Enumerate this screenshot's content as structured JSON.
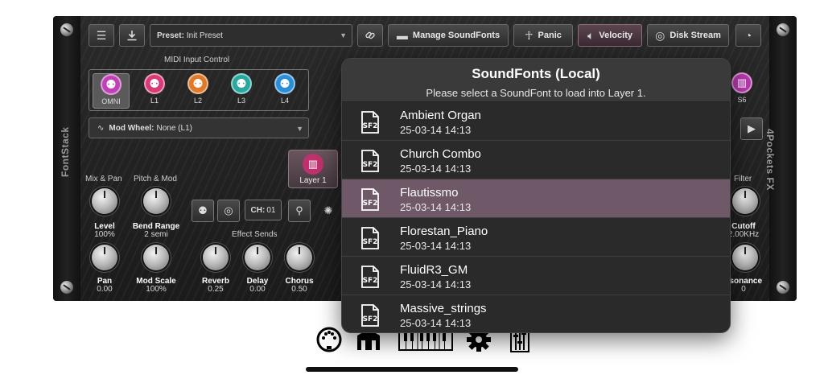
{
  "rack": {
    "side_left": "FontStack",
    "side_right": "4Pockets FX",
    "toolbar": {
      "preset_prefix": "Preset:",
      "preset_value": "Init Preset",
      "manage_soundfonts": "Manage SoundFonts",
      "panic": "Panic",
      "velocity": "Velocity",
      "disk_stream": "Disk Stream"
    },
    "midi_input_control": "MIDI Input Control",
    "midi_channels": [
      {
        "label": "OMNI",
        "color": "#c040b8"
      },
      {
        "label": "L1",
        "color": "#d83a78"
      },
      {
        "label": "L2",
        "color": "#e07a28"
      },
      {
        "label": "L3",
        "color": "#2aa8a0"
      },
      {
        "label": "L4",
        "color": "#2a8ed8"
      }
    ],
    "mod_wheel_prefix": "Mod Wheel:",
    "mod_wheel_value": "None (L1)",
    "layer_button": "Layer 1",
    "s6_label": "S6",
    "sections": {
      "mix_pan": "Mix & Pan",
      "pitch_mod": "Pitch & Mod",
      "effect_sends": "Effect Sends",
      "filter": "Filter"
    },
    "channel_box_prefix": "CH:",
    "channel_box_value": "01",
    "knobs": {
      "level": {
        "label": "Level",
        "value": "100%"
      },
      "bend_range": {
        "label": "Bend Range",
        "value": "2 semi"
      },
      "pan": {
        "label": "Pan",
        "value": "0.00"
      },
      "mod_scale": {
        "label": "Mod Scale",
        "value": "100%"
      },
      "reverb": {
        "label": "Reverb",
        "value": "0.25"
      },
      "delay": {
        "label": "Delay",
        "value": "0.00"
      },
      "chorus": {
        "label": "Chorus",
        "value": "0.50"
      },
      "cutoff": {
        "label": "Cutoff",
        "value": "2.00KHz"
      },
      "resonance": {
        "label": "esonance",
        "value": "0"
      }
    }
  },
  "popover": {
    "title": "SoundFonts (Local)",
    "subtitle": "Please select a SoundFont to load into Layer 1.",
    "icon_text": "SF2",
    "items": [
      {
        "name": "Ambient Organ",
        "date": "25-03-14 14:13"
      },
      {
        "name": "Church Combo",
        "date": "25-03-14 14:13"
      },
      {
        "name": "Flautissmo",
        "date": "25-03-14 14:13"
      },
      {
        "name": "Florestan_Piano",
        "date": "25-03-14 14:13"
      },
      {
        "name": "FluidR3_GM",
        "date": "25-03-14 14:13"
      },
      {
        "name": "Massive_strings",
        "date": "25-03-14 14:13"
      }
    ],
    "selected_index": 2
  },
  "bottom_bar": {
    "icons": [
      "midi-connector-icon",
      "instrument-icon",
      "keyboard-icon",
      "gear-icon",
      "mixer-icon"
    ]
  }
}
